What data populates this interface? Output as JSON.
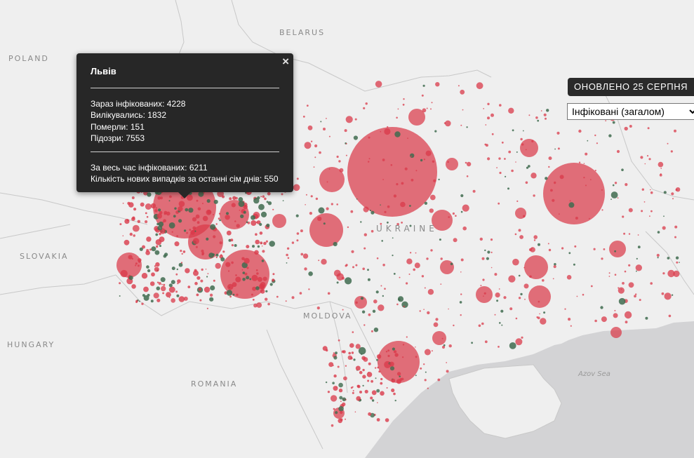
{
  "map": {
    "country_labels": [
      {
        "key": "belarus",
        "text": "BELARUS"
      },
      {
        "key": "poland",
        "text": "POLAND"
      },
      {
        "key": "slovakia",
        "text": "SLOVAKIA"
      },
      {
        "key": "hungary",
        "text": "HUNGARY"
      },
      {
        "key": "romania",
        "text": "ROMANIA"
      },
      {
        "key": "moldova",
        "text": "MOLDOVA"
      },
      {
        "key": "ukraine",
        "text": "UKRAINE"
      }
    ],
    "sea_label": "Azov Sea",
    "colors": {
      "land": "#efefef",
      "water": "#d3d3d5",
      "border": "#c8c8c8",
      "infected_marker": "#d93a4a",
      "recovered_marker": "#3f6b4f"
    }
  },
  "popup": {
    "title": "Львів",
    "current_infected": "Зараз інфікованих: 4228",
    "recovered": "Вилікувались: 1832",
    "deaths": "Померли: 151",
    "suspected": "Підозри: 7553",
    "total_infected": "За весь час інфікованих: 6211",
    "new_cases_week": "Кількість нових випадків за останні сім днів: 550",
    "close_symbol": "×"
  },
  "controls": {
    "updated_label": "ОНОВЛЕНО 25 СЕРПНЯ",
    "metric_select": {
      "selected": "Інфіковані (загалом)"
    }
  }
}
